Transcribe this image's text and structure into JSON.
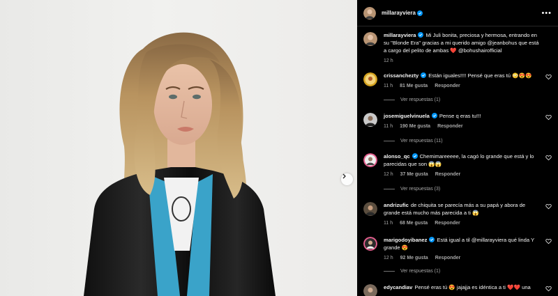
{
  "post": {
    "username": "millarayviera",
    "more_label": "•••",
    "caption": {
      "username": "millarayviera",
      "text": "Mi Juli bonita, preciosa y hermosa, entrando en su \"Blonde Era\" gracias a mi querido amigo @jeanbohus que está a cargo del pelito de ambas ❤️ @bohushairofficial",
      "time": "12 h"
    }
  },
  "comments": [
    {
      "username": "crissanchezty",
      "verified": true,
      "text": "Están iguales!!!! Pensé que eras tú 😳😍😍",
      "time": "11 h",
      "likes": "81 Me gusta",
      "reply": "Responder",
      "replies": "Ver respuestas (1)"
    },
    {
      "username": "josemiguelvinuela",
      "verified": true,
      "text": "Pense q eras tu!!!",
      "time": "11 h",
      "likes": "190 Me gusta",
      "reply": "Responder",
      "replies": "Ver respuestas (11)"
    },
    {
      "username": "alonso_qc",
      "verified": true,
      "text": "Chemimareeeee, la cagó lo grande que está y lo parecidas que son 😱😱",
      "time": "12 h",
      "likes": "37 Me gusta",
      "reply": "Responder",
      "replies": "Ver respuestas (3)"
    },
    {
      "username": "andrizufic",
      "verified": false,
      "text": "de chiquita se parecía más a su papá y abora de grande está mucho más parecida a ti 😱",
      "time": "11 h",
      "likes": "68 Me gusta",
      "reply": "Responder",
      "replies": ""
    },
    {
      "username": "marigodoyibanez",
      "verified": true,
      "text": "Está igual a til @millarayviera qué linda Y grande 😍",
      "time": "12 h",
      "likes": "92 Me gusta",
      "reply": "Responder",
      "replies": "Ver respuestas (1)"
    },
    {
      "username": "edycandiav",
      "verified": false,
      "text": "Pensé eras tú 😍 jajajja es idéntica a ti ❤️❤️ una",
      "time": "",
      "likes": "",
      "reply": "",
      "replies": ""
    }
  ],
  "colors": {
    "verified": "#0095f6",
    "muted": "#a8a8a8",
    "background": "#000000"
  },
  "icons": {
    "next": "chevron-right-icon",
    "like": "heart-icon",
    "verified": "verified-badge-icon"
  }
}
